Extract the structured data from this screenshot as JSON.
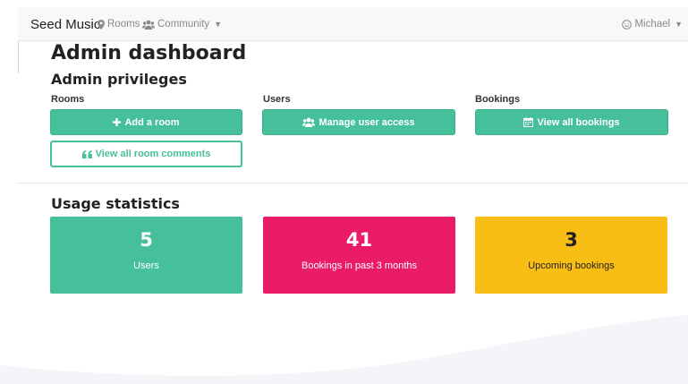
{
  "navbar": {
    "brand": "Seed Music",
    "rooms": "Rooms",
    "community": "Community",
    "user": "Michael"
  },
  "page": {
    "title": "Admin dashboard"
  },
  "admin": {
    "title": "Admin privileges",
    "rooms_label": "Rooms",
    "users_label": "Users",
    "bookings_label": "Bookings",
    "add_room": "Add a room",
    "view_comments": "View all room comments",
    "manage_users": "Manage user access",
    "view_bookings": "View all bookings"
  },
  "usage": {
    "title": "Usage statistics",
    "stats": [
      {
        "value": "5",
        "label": "Users"
      },
      {
        "value": "41",
        "label": "Bookings in past 3 months"
      },
      {
        "value": "3",
        "label": "Upcoming bookings"
      }
    ]
  },
  "colors": {
    "green": "#46c09a",
    "pink": "#ea1b67",
    "yellow": "#f8be16"
  }
}
